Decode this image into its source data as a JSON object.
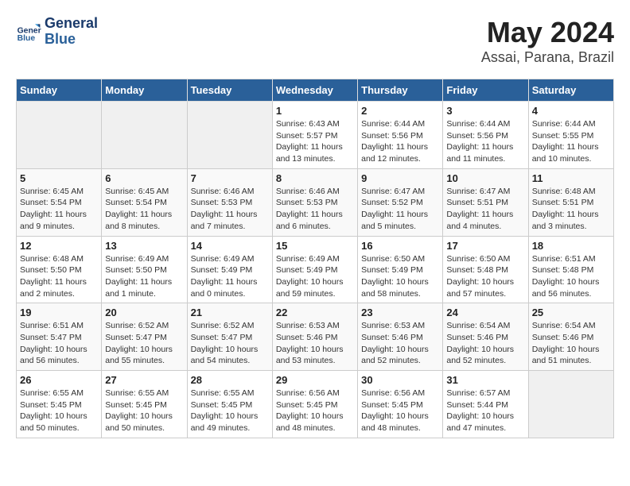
{
  "header": {
    "logo_line1": "General",
    "logo_line2": "Blue",
    "title": "May 2024",
    "subtitle": "Assai, Parana, Brazil"
  },
  "weekdays": [
    "Sunday",
    "Monday",
    "Tuesday",
    "Wednesday",
    "Thursday",
    "Friday",
    "Saturday"
  ],
  "weeks": [
    [
      {
        "day": "",
        "info": ""
      },
      {
        "day": "",
        "info": ""
      },
      {
        "day": "",
        "info": ""
      },
      {
        "day": "1",
        "info": "Sunrise: 6:43 AM\nSunset: 5:57 PM\nDaylight: 11 hours\nand 13 minutes."
      },
      {
        "day": "2",
        "info": "Sunrise: 6:44 AM\nSunset: 5:56 PM\nDaylight: 11 hours\nand 12 minutes."
      },
      {
        "day": "3",
        "info": "Sunrise: 6:44 AM\nSunset: 5:56 PM\nDaylight: 11 hours\nand 11 minutes."
      },
      {
        "day": "4",
        "info": "Sunrise: 6:44 AM\nSunset: 5:55 PM\nDaylight: 11 hours\nand 10 minutes."
      }
    ],
    [
      {
        "day": "5",
        "info": "Sunrise: 6:45 AM\nSunset: 5:54 PM\nDaylight: 11 hours\nand 9 minutes."
      },
      {
        "day": "6",
        "info": "Sunrise: 6:45 AM\nSunset: 5:54 PM\nDaylight: 11 hours\nand 8 minutes."
      },
      {
        "day": "7",
        "info": "Sunrise: 6:46 AM\nSunset: 5:53 PM\nDaylight: 11 hours\nand 7 minutes."
      },
      {
        "day": "8",
        "info": "Sunrise: 6:46 AM\nSunset: 5:53 PM\nDaylight: 11 hours\nand 6 minutes."
      },
      {
        "day": "9",
        "info": "Sunrise: 6:47 AM\nSunset: 5:52 PM\nDaylight: 11 hours\nand 5 minutes."
      },
      {
        "day": "10",
        "info": "Sunrise: 6:47 AM\nSunset: 5:51 PM\nDaylight: 11 hours\nand 4 minutes."
      },
      {
        "day": "11",
        "info": "Sunrise: 6:48 AM\nSunset: 5:51 PM\nDaylight: 11 hours\nand 3 minutes."
      }
    ],
    [
      {
        "day": "12",
        "info": "Sunrise: 6:48 AM\nSunset: 5:50 PM\nDaylight: 11 hours\nand 2 minutes."
      },
      {
        "day": "13",
        "info": "Sunrise: 6:49 AM\nSunset: 5:50 PM\nDaylight: 11 hours\nand 1 minute."
      },
      {
        "day": "14",
        "info": "Sunrise: 6:49 AM\nSunset: 5:49 PM\nDaylight: 11 hours\nand 0 minutes."
      },
      {
        "day": "15",
        "info": "Sunrise: 6:49 AM\nSunset: 5:49 PM\nDaylight: 10 hours\nand 59 minutes."
      },
      {
        "day": "16",
        "info": "Sunrise: 6:50 AM\nSunset: 5:49 PM\nDaylight: 10 hours\nand 58 minutes."
      },
      {
        "day": "17",
        "info": "Sunrise: 6:50 AM\nSunset: 5:48 PM\nDaylight: 10 hours\nand 57 minutes."
      },
      {
        "day": "18",
        "info": "Sunrise: 6:51 AM\nSunset: 5:48 PM\nDaylight: 10 hours\nand 56 minutes."
      }
    ],
    [
      {
        "day": "19",
        "info": "Sunrise: 6:51 AM\nSunset: 5:47 PM\nDaylight: 10 hours\nand 56 minutes."
      },
      {
        "day": "20",
        "info": "Sunrise: 6:52 AM\nSunset: 5:47 PM\nDaylight: 10 hours\nand 55 minutes."
      },
      {
        "day": "21",
        "info": "Sunrise: 6:52 AM\nSunset: 5:47 PM\nDaylight: 10 hours\nand 54 minutes."
      },
      {
        "day": "22",
        "info": "Sunrise: 6:53 AM\nSunset: 5:46 PM\nDaylight: 10 hours\nand 53 minutes."
      },
      {
        "day": "23",
        "info": "Sunrise: 6:53 AM\nSunset: 5:46 PM\nDaylight: 10 hours\nand 52 minutes."
      },
      {
        "day": "24",
        "info": "Sunrise: 6:54 AM\nSunset: 5:46 PM\nDaylight: 10 hours\nand 52 minutes."
      },
      {
        "day": "25",
        "info": "Sunrise: 6:54 AM\nSunset: 5:46 PM\nDaylight: 10 hours\nand 51 minutes."
      }
    ],
    [
      {
        "day": "26",
        "info": "Sunrise: 6:55 AM\nSunset: 5:45 PM\nDaylight: 10 hours\nand 50 minutes."
      },
      {
        "day": "27",
        "info": "Sunrise: 6:55 AM\nSunset: 5:45 PM\nDaylight: 10 hours\nand 50 minutes."
      },
      {
        "day": "28",
        "info": "Sunrise: 6:55 AM\nSunset: 5:45 PM\nDaylight: 10 hours\nand 49 minutes."
      },
      {
        "day": "29",
        "info": "Sunrise: 6:56 AM\nSunset: 5:45 PM\nDaylight: 10 hours\nand 48 minutes."
      },
      {
        "day": "30",
        "info": "Sunrise: 6:56 AM\nSunset: 5:45 PM\nDaylight: 10 hours\nand 48 minutes."
      },
      {
        "day": "31",
        "info": "Sunrise: 6:57 AM\nSunset: 5:44 PM\nDaylight: 10 hours\nand 47 minutes."
      },
      {
        "day": "",
        "info": ""
      }
    ]
  ]
}
